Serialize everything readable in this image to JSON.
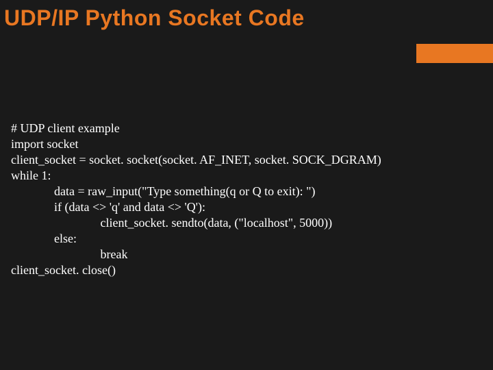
{
  "title": "UDP/IP Python Socket Code",
  "code": {
    "l0": "# UDP client example",
    "l1": "import socket",
    "l2": "client_socket = socket. socket(socket. AF_INET, socket. SOCK_DGRAM)",
    "l3": "while 1:",
    "l4": "              data = raw_input(\"Type something(q or Q to exit): \")",
    "l5": "              if (data <> 'q' and data <> 'Q'):",
    "l6": "                             client_socket. sendto(data, (\"localhost\", 5000))",
    "l7": "              else:",
    "l8": "                             break",
    "l9": "client_socket. close()"
  }
}
